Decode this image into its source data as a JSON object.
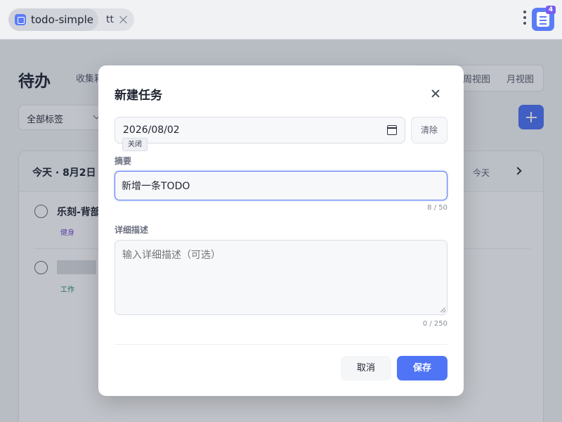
{
  "browser": {
    "app_tab_title": "todo-simple",
    "second_tab_title": "tt",
    "extension_badge": "4"
  },
  "page": {
    "title": "待办",
    "collect_label": "收集箱",
    "view_week": "周视图",
    "view_month": "月视图",
    "tag_filter": "全部标签",
    "card_date": "今天 · 8月2日",
    "today_button": "今天",
    "todos": [
      {
        "title": "乐刻-背部",
        "tag": "健身",
        "tag_color": "#7a4fd0"
      },
      {
        "title": "",
        "tag": "工作",
        "tag_color": "#2a8a6a"
      }
    ]
  },
  "modal": {
    "title": "新建任务",
    "date_value": "2026/08/02",
    "clear_label": "清除",
    "tooltip": "关闭",
    "summary_label": "摘要",
    "summary_value": "新增一条TODO",
    "summary_count": "8 / 50",
    "desc_label": "详细描述",
    "desc_placeholder": "输入详细描述（可选）",
    "desc_count": "0 / 250",
    "cancel_label": "取消",
    "save_label": "保存"
  },
  "colors": {
    "accent": "#4f74f5"
  }
}
